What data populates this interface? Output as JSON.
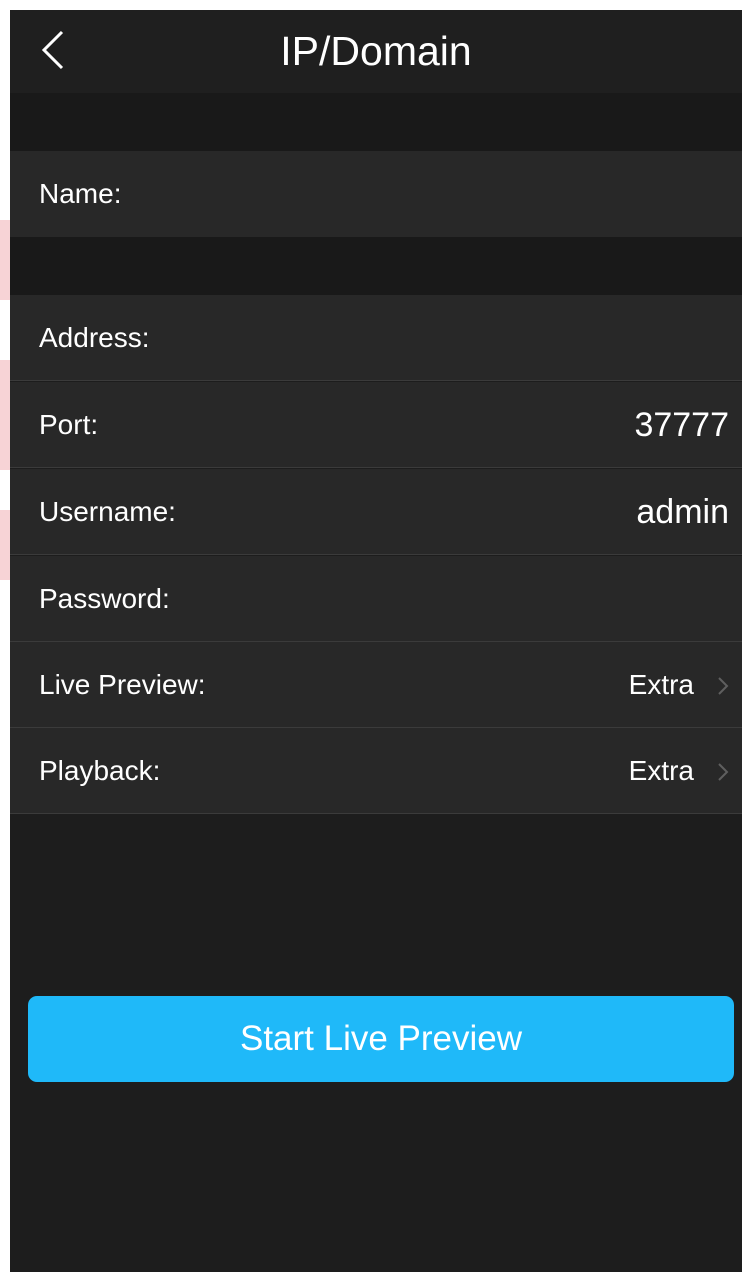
{
  "header": {
    "title": "IP/Domain",
    "back_icon": "chevron-left-icon"
  },
  "form": {
    "name": {
      "label": "Name:",
      "value": ""
    },
    "address": {
      "label": "Address:",
      "value": ""
    },
    "port": {
      "label": "Port:",
      "value": "37777"
    },
    "username": {
      "label": "Username:",
      "value": "admin"
    },
    "password": {
      "label": "Password:",
      "value": ""
    },
    "live_preview": {
      "label": "Live Preview:",
      "value": "Extra",
      "icon": "chevron-right-icon"
    },
    "playback": {
      "label": "Playback:",
      "value": "Extra",
      "icon": "chevron-right-icon"
    }
  },
  "actions": {
    "start_label": "Start Live Preview"
  },
  "colors": {
    "background": "#1d1d1d",
    "row": "#282828",
    "accent": "#1fb9f9",
    "text": "#ffffff"
  }
}
